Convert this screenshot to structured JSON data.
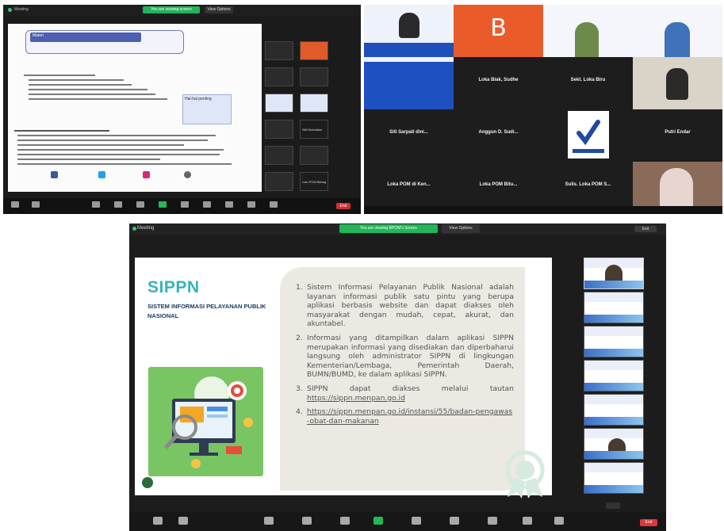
{
  "top_left": {
    "meeting_label": "Meeting",
    "share_chip": "You are viewing screen",
    "view_chip": "View Options",
    "slide_box_title": "Materi",
    "note_box": "Hal-hal penting",
    "gallery_names": [
      "",
      "",
      "",
      "",
      "Sitti Nurhaliza",
      "",
      "",
      "Lulu POM Bitung"
    ],
    "end_label": "End"
  },
  "top_right": {
    "tiles": [
      {
        "name": "",
        "kind": "video-slide"
      },
      {
        "name": "",
        "kind": "orange",
        "letter": "B"
      },
      {
        "name": "",
        "kind": "banner"
      },
      {
        "name": "",
        "kind": "banner"
      },
      {
        "name": "",
        "kind": "blue-slide"
      },
      {
        "name": "Loka Biak, Sudhe",
        "kind": "name"
      },
      {
        "name": "Sekt. Loka Biru",
        "kind": "name"
      },
      {
        "name": "",
        "kind": "video"
      },
      {
        "name": "Siti Sarpati dini...",
        "kind": "name"
      },
      {
        "name": "Anggun D. Sudi...",
        "kind": "name"
      },
      {
        "name": "",
        "kind": "logo"
      },
      {
        "name": "Putri Endar",
        "kind": "name"
      },
      {
        "name": "Loka POM di Ken...",
        "kind": "name"
      },
      {
        "name": "Loka POM Bitu...",
        "kind": "name"
      },
      {
        "name": "Sulis. Loka POM S...",
        "kind": "name"
      },
      {
        "name": "",
        "kind": "video"
      }
    ]
  },
  "bottom": {
    "meeting_label": "Meeting",
    "share_chip": "You are viewing BPOM's Screen",
    "view_chip": "View Options",
    "exit_label": "Exit",
    "slide": {
      "title": "SIPPN",
      "subtitle": "SISTEM INFORMASI PELAYANAN PUBLIK NASIONAL",
      "items": [
        {
          "num": "1.",
          "text": "Sistem Informasi Pelayanan Publik Nasional adalah layanan informasi publik satu pintu yang berupa aplikasi berbasis website dan dapat diakses oleh masyarakat dengan mudah, cepat, akurat, dan akuntabel."
        },
        {
          "num": "2.",
          "text": "Informasi yang ditampilkan dalam aplikasi SIPPN merupakan informasi yang disediakan dan diperbaharui langsung oleh administrator SIPPN di lingkungan Kementerian/Lembaga, Pemerintah Daerah, BUMN/BUMD, ke dalam aplikasi SIPPN."
        },
        {
          "num": "3.",
          "text": "SIPPN dapat diakses melalui tautan",
          "link": "https://sippn.menpan.go.id"
        },
        {
          "num": "4.",
          "link": "https://sippn.menpan.go.id/instansi/55/badan-pengawas-obat-dan-makanan"
        }
      ]
    },
    "end_label": "End"
  }
}
